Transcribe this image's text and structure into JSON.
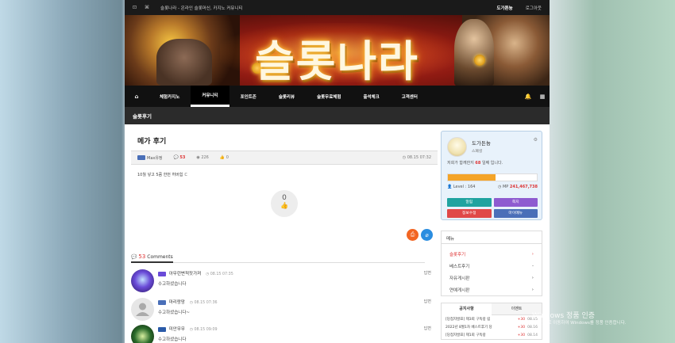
{
  "topbar": {
    "tagline": "슬롯나라 - 온라인 슬롯머신, 카지노 커뮤니티",
    "username": "도가튼늉",
    "logout": "로그아웃"
  },
  "banner": {
    "logo_text": "슬롯나라"
  },
  "nav": {
    "items": [
      "체험카지노",
      "커뮤니티",
      "포인트존",
      "슬롯리뷰",
      "슬롯무료체험",
      "출석체크",
      "고객센터"
    ],
    "active_index": 1
  },
  "section_title": "슬롯후기",
  "post": {
    "title": "메가 후기",
    "author": "Max유정",
    "comments": "53",
    "views": "226",
    "likes": "0",
    "date": "08.15 07:32",
    "body": "10월 넣고 5콤 한번 허버힙 ㄷ",
    "like_count": "0"
  },
  "comments": {
    "count": "53",
    "label": "Comments",
    "reply_label": "답변",
    "items": [
      {
        "name": "아무런변적잣가져",
        "time": "08.15 07:35",
        "text": "수고하셨습니다"
      },
      {
        "name": "마리랑망",
        "time": "08.15 07:36",
        "text": "수고하셨습니다~"
      },
      {
        "name": "미안무무",
        "time": "08.15 09:09",
        "text": "수고하셨습니다"
      }
    ]
  },
  "profile": {
    "name": "도가튼늉",
    "level_label": "스폐셜",
    "since_prefix": "저희가 함께한지",
    "since_days": "68",
    "since_suffix": "일째 입니다.",
    "exp_percent": 54,
    "level_text": "Level : 164",
    "mp_label": "MP",
    "mp_value": "241,467,738",
    "buttons": [
      "알림",
      "쪽지",
      "정보수정",
      "마이메뉴"
    ]
  },
  "menu": {
    "header": "메뉴",
    "items": [
      "슬롯후기",
      "베스트후기",
      "자유게시판",
      "연예게시판"
    ],
    "active_index": 0
  },
  "notice": {
    "tabs": [
      "공지사항",
      "이벤트"
    ],
    "rows": [
      {
        "title": "[당첨자발표] 제3회 구독랑 림",
        "count": "+30",
        "date": "08.15"
      },
      {
        "title": "2022년 8월1차 베스트후기 당",
        "count": "+30",
        "date": "08.16"
      },
      {
        "title": "[당첨자발표] 제1회 구독랑",
        "count": "+30",
        "date": "08.14"
      }
    ]
  },
  "watermark": {
    "title": "Windows 정품 인증",
    "subtitle": "[설정]으로 이동하여 Windows를 정품 인증합니다."
  }
}
